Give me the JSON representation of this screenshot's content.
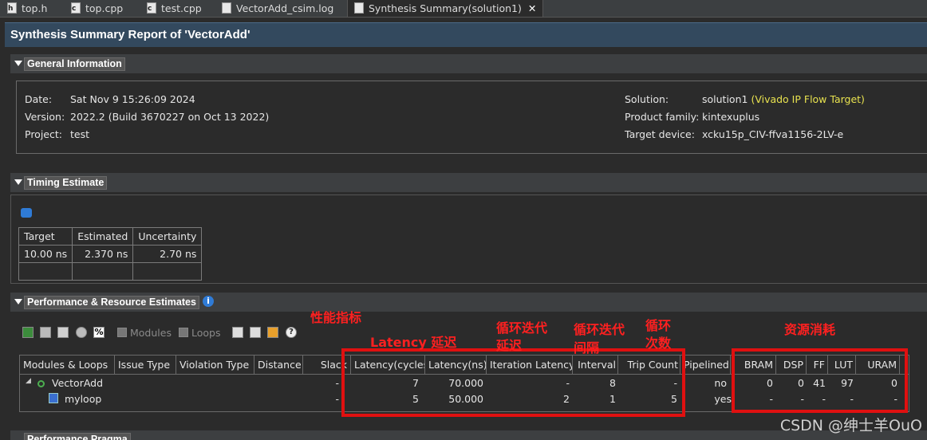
{
  "tabs": [
    {
      "label": "top.h",
      "glyph": "h"
    },
    {
      "label": "top.cpp",
      "glyph": "c"
    },
    {
      "label": "test.cpp",
      "glyph": "c"
    },
    {
      "label": "VectorAdd_csim.log",
      "glyph": ""
    },
    {
      "label": "Synthesis Summary(solution1)",
      "glyph": "",
      "close": "✕"
    }
  ],
  "report_title": "Synthesis Summary Report of 'VectorAdd'",
  "general": {
    "heading": "General Information",
    "date_label": "Date:",
    "date": "Sat Nov 9 15:26:09 2024",
    "version_label": "Version:",
    "version": "2022.2 (Build 3670227 on Oct 13 2022)",
    "project_label": "Project:",
    "project": "test",
    "solution_label": "Solution:",
    "solution": "solution1",
    "solution_target": "(Vivado IP Flow Target)",
    "family_label": "Product family:",
    "family": "kintexuplus",
    "device_label": "Target device:",
    "device": "xcku15p_CIV-ffva1156-2LV-e"
  },
  "timing": {
    "heading": "Timing Estimate",
    "headers": [
      "Target",
      "Estimated",
      "Uncertainty"
    ],
    "row": [
      "10.00 ns",
      "2.370 ns",
      "2.70 ns"
    ]
  },
  "perf": {
    "heading": "Performance & Resource Estimates",
    "toggle_modules": "Modules",
    "toggle_loops": "Loops",
    "headers": [
      "Modules & Loops",
      "Issue Type",
      "Violation Type",
      "Distance",
      "Slack",
      "Latency(cycles)",
      "Latency(ns)",
      "Iteration Latency",
      "Interval",
      "Trip Count",
      "Pipelined",
      "BRAM",
      "DSP",
      "FF",
      "LUT",
      "URAM"
    ],
    "rows": [
      {
        "name": "VectorAdd",
        "slack": "-",
        "lat_cycles": "7",
        "lat_ns": "70.000",
        "iter_lat": "-",
        "interval": "8",
        "trip": "-",
        "pipelined": "no",
        "bram": "0",
        "dsp": "0",
        "ff": "41",
        "lut": "97",
        "uram": "0"
      },
      {
        "name": "myloop",
        "slack": "-",
        "lat_cycles": "5",
        "lat_ns": "50.000",
        "iter_lat": "2",
        "interval": "1",
        "trip": "5",
        "pipelined": "yes",
        "bram": "-",
        "dsp": "-",
        "ff": "-",
        "lut": "-",
        "uram": "-"
      }
    ]
  },
  "next_section_partial": "Performance Pragma",
  "annotations": {
    "perf_metric": "性能指标",
    "latency": "Latency 延迟",
    "iter_latency_1": "循环迭代",
    "iter_latency_2": "延迟",
    "interval_1": "循环迭代",
    "interval_2": "间隔",
    "trip_1": "循环",
    "trip_2": "次数",
    "resource": "资源消耗"
  },
  "watermark": "CSDN @绅士羊OuO",
  "colors": {
    "annotation": "#e01010",
    "title_bar": "#33495e",
    "background": "#2b2b2b",
    "highlight": "#e8e24f"
  }
}
